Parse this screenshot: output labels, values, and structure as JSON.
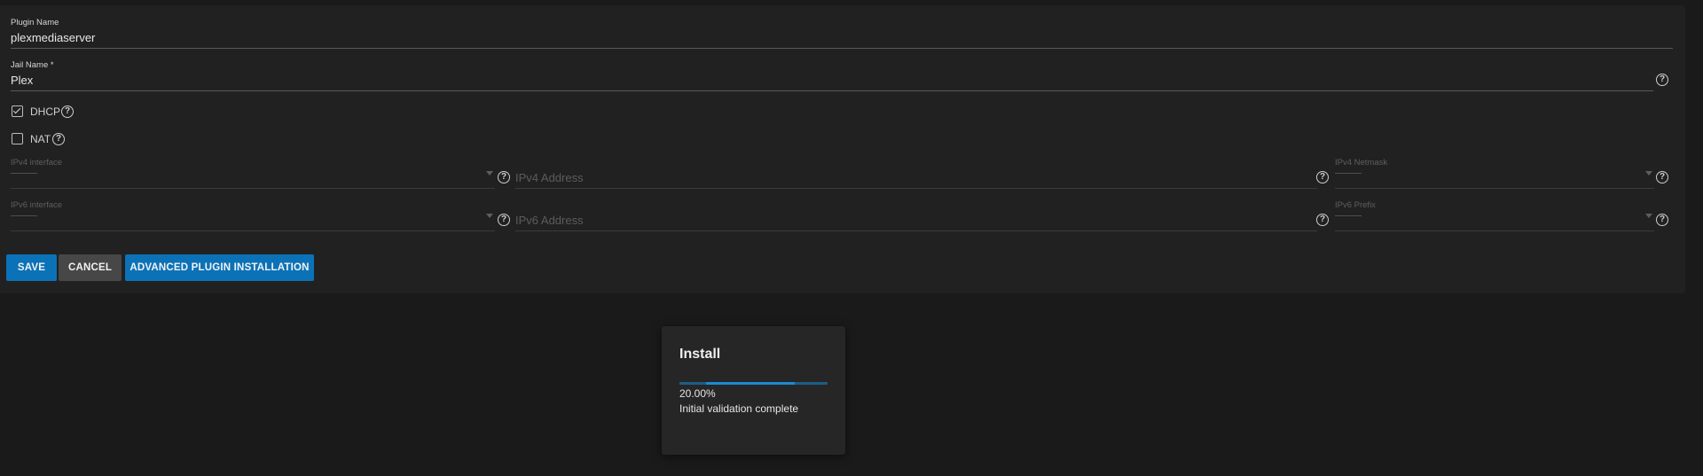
{
  "form": {
    "plugin_name": {
      "label": "Plugin Name",
      "value": "plexmediaserver"
    },
    "jail_name": {
      "label": "Jail Name *",
      "value": "Plex"
    },
    "dhcp": {
      "label": "DHCP",
      "checked": true
    },
    "nat": {
      "label": "NAT",
      "checked": false
    },
    "ipv4_interface": {
      "label": "IPv4 interface",
      "value": "——"
    },
    "ipv4_address": {
      "placeholder": "IPv4 Address"
    },
    "ipv4_netmask": {
      "label": "IPv4 Netmask",
      "value": "——"
    },
    "ipv6_interface": {
      "label": "IPv6 interface",
      "value": "——"
    },
    "ipv6_address": {
      "placeholder": "IPv6 Address"
    },
    "ipv6_prefix": {
      "label": "IPv6 Prefix",
      "value": "——"
    }
  },
  "buttons": {
    "save": "SAVE",
    "cancel": "CANCEL",
    "advanced": "ADVANCED PLUGIN INSTALLATION"
  },
  "dialog": {
    "title": "Install",
    "progress_percent": 20,
    "progress_text": "20.00%",
    "status": "Initial validation complete"
  },
  "icons": {
    "help": "help-circle-icon",
    "checkbox_checked": "check-icon",
    "dropdown": "caret-down-icon"
  },
  "colors": {
    "primary": "#0b72b8",
    "secondary": "#474747",
    "background": "#1a1a1a",
    "card": "#212121"
  }
}
